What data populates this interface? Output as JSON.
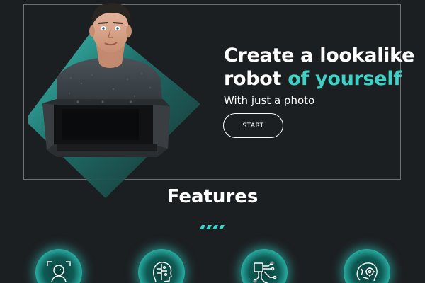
{
  "hero": {
    "title_line1": "Create a lookalike",
    "title_line2_plain": "robot ",
    "title_line2_accent": "of yourself",
    "subtitle": "With just a photo",
    "start_button": "START"
  },
  "features": {
    "title": "Features",
    "icons": [
      "face-scan-icon",
      "head-profile-icon",
      "circuit-chip-icon",
      "brain-gear-icon"
    ]
  },
  "colors": {
    "background": "#1c1f22",
    "accent": "#3ed2c7",
    "frame": "#6d7277"
  }
}
